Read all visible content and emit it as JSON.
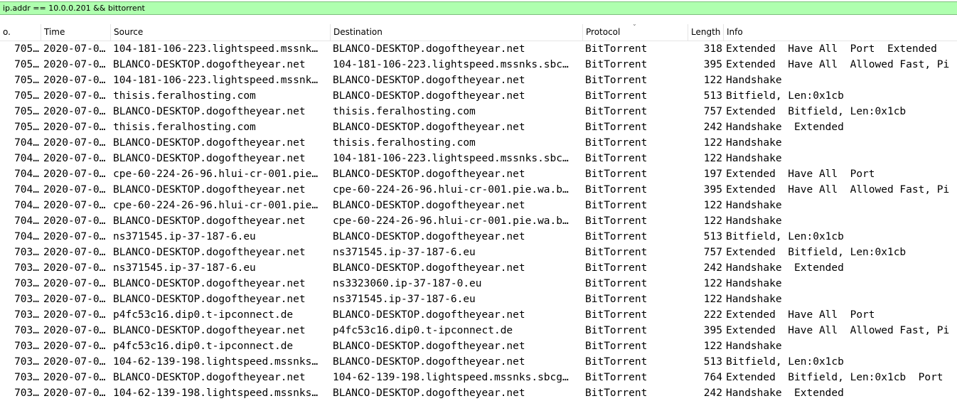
{
  "filter": {
    "value": "ip.addr == 10.0.0.201 && bittorrent"
  },
  "columns": {
    "no": "o.",
    "time": "Time",
    "source": "Source",
    "destination": "Destination",
    "protocol": "Protocol",
    "length": "Length",
    "info": "Info"
  },
  "rows": [
    {
      "no": "705…",
      "time": "2020-07-0…",
      "source": "104-181-106-223.lightspeed.mssnk…",
      "destination": "BLANCO-DESKTOP.dogoftheyear.net",
      "protocol": "BitTorrent",
      "length": "318",
      "info": "Extended  Have All  Port  Extended"
    },
    {
      "no": "705…",
      "time": "2020-07-0…",
      "source": "BLANCO-DESKTOP.dogoftheyear.net",
      "destination": "104-181-106-223.lightspeed.mssnks.sbc…",
      "protocol": "BitTorrent",
      "length": "395",
      "info": "Extended  Have All  Allowed Fast, Pi"
    },
    {
      "no": "705…",
      "time": "2020-07-0…",
      "source": "104-181-106-223.lightspeed.mssnk…",
      "destination": "BLANCO-DESKTOP.dogoftheyear.net",
      "protocol": "BitTorrent",
      "length": "122",
      "info": "Handshake"
    },
    {
      "no": "705…",
      "time": "2020-07-0…",
      "source": "thisis.feralhosting.com",
      "destination": "BLANCO-DESKTOP.dogoftheyear.net",
      "protocol": "BitTorrent",
      "length": "513",
      "info": "Bitfield, Len:0x1cb"
    },
    {
      "no": "705…",
      "time": "2020-07-0…",
      "source": "BLANCO-DESKTOP.dogoftheyear.net",
      "destination": "thisis.feralhosting.com",
      "protocol": "BitTorrent",
      "length": "757",
      "info": "Extended  Bitfield, Len:0x1cb"
    },
    {
      "no": "705…",
      "time": "2020-07-0…",
      "source": "thisis.feralhosting.com",
      "destination": "BLANCO-DESKTOP.dogoftheyear.net",
      "protocol": "BitTorrent",
      "length": "242",
      "info": "Handshake  Extended"
    },
    {
      "no": "704…",
      "time": "2020-07-0…",
      "source": "BLANCO-DESKTOP.dogoftheyear.net",
      "destination": "thisis.feralhosting.com",
      "protocol": "BitTorrent",
      "length": "122",
      "info": "Handshake"
    },
    {
      "no": "704…",
      "time": "2020-07-0…",
      "source": "BLANCO-DESKTOP.dogoftheyear.net",
      "destination": "104-181-106-223.lightspeed.mssnks.sbc…",
      "protocol": "BitTorrent",
      "length": "122",
      "info": "Handshake"
    },
    {
      "no": "704…",
      "time": "2020-07-0…",
      "source": "cpe-60-224-26-96.hlui-cr-001.pie…",
      "destination": "BLANCO-DESKTOP.dogoftheyear.net",
      "protocol": "BitTorrent",
      "length": "197",
      "info": "Extended  Have All  Port"
    },
    {
      "no": "704…",
      "time": "2020-07-0…",
      "source": "BLANCO-DESKTOP.dogoftheyear.net",
      "destination": "cpe-60-224-26-96.hlui-cr-001.pie.wa.b…",
      "protocol": "BitTorrent",
      "length": "395",
      "info": "Extended  Have All  Allowed Fast, Pi"
    },
    {
      "no": "704…",
      "time": "2020-07-0…",
      "source": "cpe-60-224-26-96.hlui-cr-001.pie…",
      "destination": "BLANCO-DESKTOP.dogoftheyear.net",
      "protocol": "BitTorrent",
      "length": "122",
      "info": "Handshake"
    },
    {
      "no": "704…",
      "time": "2020-07-0…",
      "source": "BLANCO-DESKTOP.dogoftheyear.net",
      "destination": "cpe-60-224-26-96.hlui-cr-001.pie.wa.b…",
      "protocol": "BitTorrent",
      "length": "122",
      "info": "Handshake"
    },
    {
      "no": "704…",
      "time": "2020-07-0…",
      "source": "ns371545.ip-37-187-6.eu",
      "destination": "BLANCO-DESKTOP.dogoftheyear.net",
      "protocol": "BitTorrent",
      "length": "513",
      "info": "Bitfield, Len:0x1cb"
    },
    {
      "no": "703…",
      "time": "2020-07-0…",
      "source": "BLANCO-DESKTOP.dogoftheyear.net",
      "destination": "ns371545.ip-37-187-6.eu",
      "protocol": "BitTorrent",
      "length": "757",
      "info": "Extended  Bitfield, Len:0x1cb"
    },
    {
      "no": "703…",
      "time": "2020-07-0…",
      "source": "ns371545.ip-37-187-6.eu",
      "destination": "BLANCO-DESKTOP.dogoftheyear.net",
      "protocol": "BitTorrent",
      "length": "242",
      "info": "Handshake  Extended"
    },
    {
      "no": "703…",
      "time": "2020-07-0…",
      "source": "BLANCO-DESKTOP.dogoftheyear.net",
      "destination": "ns3323060.ip-37-187-0.eu",
      "protocol": "BitTorrent",
      "length": "122",
      "info": "Handshake"
    },
    {
      "no": "703…",
      "time": "2020-07-0…",
      "source": "BLANCO-DESKTOP.dogoftheyear.net",
      "destination": "ns371545.ip-37-187-6.eu",
      "protocol": "BitTorrent",
      "length": "122",
      "info": "Handshake"
    },
    {
      "no": "703…",
      "time": "2020-07-0…",
      "source": "p4fc53c16.dip0.t-ipconnect.de",
      "destination": "BLANCO-DESKTOP.dogoftheyear.net",
      "protocol": "BitTorrent",
      "length": "222",
      "info": "Extended  Have All  Port"
    },
    {
      "no": "703…",
      "time": "2020-07-0…",
      "source": "BLANCO-DESKTOP.dogoftheyear.net",
      "destination": "p4fc53c16.dip0.t-ipconnect.de",
      "protocol": "BitTorrent",
      "length": "395",
      "info": "Extended  Have All  Allowed Fast, Pi"
    },
    {
      "no": "703…",
      "time": "2020-07-0…",
      "source": "p4fc53c16.dip0.t-ipconnect.de",
      "destination": "BLANCO-DESKTOP.dogoftheyear.net",
      "protocol": "BitTorrent",
      "length": "122",
      "info": "Handshake"
    },
    {
      "no": "703…",
      "time": "2020-07-0…",
      "source": "104-62-139-198.lightspeed.mssnks…",
      "destination": "BLANCO-DESKTOP.dogoftheyear.net",
      "protocol": "BitTorrent",
      "length": "513",
      "info": "Bitfield, Len:0x1cb"
    },
    {
      "no": "703…",
      "time": "2020-07-0…",
      "source": "BLANCO-DESKTOP.dogoftheyear.net",
      "destination": "104-62-139-198.lightspeed.mssnks.sbcg…",
      "protocol": "BitTorrent",
      "length": "764",
      "info": "Extended  Bitfield, Len:0x1cb  Port"
    },
    {
      "no": "703…",
      "time": "2020-07-0…",
      "source": "104-62-139-198.lightspeed.mssnks…",
      "destination": "BLANCO-DESKTOP.dogoftheyear.net",
      "protocol": "BitTorrent",
      "length": "242",
      "info": "Handshake  Extended"
    }
  ]
}
